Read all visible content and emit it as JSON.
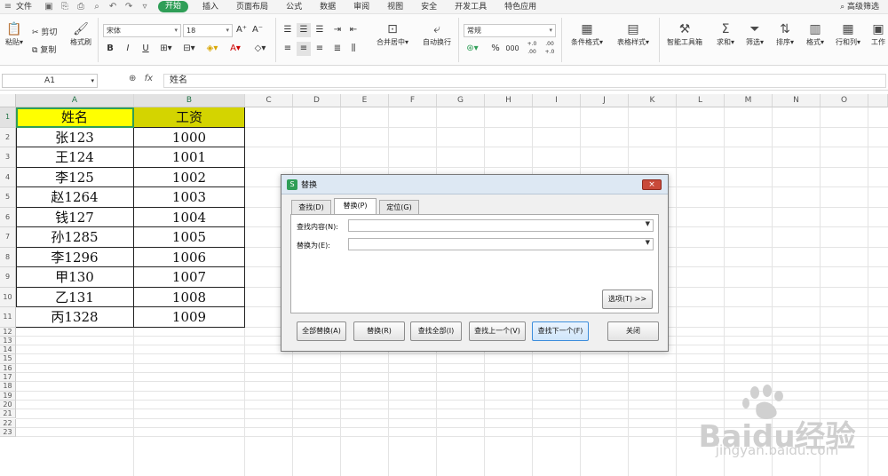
{
  "menubar": {
    "file": "文件",
    "tabs": [
      "开始",
      "插入",
      "页面布局",
      "公式",
      "数据",
      "审阅",
      "视图",
      "安全",
      "开发工具",
      "特色应用"
    ],
    "active_tab": "开始",
    "search": "高级筛选"
  },
  "ribbon": {
    "paste": "粘贴",
    "cut": "剪切",
    "copy": "复制",
    "format_painter": "格式刷",
    "font": "宋体",
    "font_size": "18",
    "bold": "B",
    "italic": "I",
    "underline": "U",
    "merge": "合并居中",
    "wrap": "自动换行",
    "number_format": "常规",
    "percent": "%",
    "thousands": "000",
    "dec_inc": "+.0\n.00",
    "dec_dec": ".00\n+.0",
    "cond_format": "条件格式",
    "table_style": "表格样式",
    "smart_toolbox": "智能工具箱",
    "sum": "求和",
    "filter": "筛选",
    "sort": "排序",
    "format": "格式",
    "row_col": "行和列",
    "worksheet": "工作"
  },
  "formula_bar": {
    "cell_ref": "A1",
    "fx": "fx",
    "value": "姓名"
  },
  "grid": {
    "columns": [
      "A",
      "B",
      "C",
      "D",
      "E",
      "F",
      "G",
      "H",
      "I",
      "J",
      "K",
      "L",
      "M",
      "N",
      "O"
    ],
    "rows": [
      "1",
      "2",
      "3",
      "4",
      "5",
      "6",
      "7",
      "8",
      "9",
      "10",
      "11",
      "12",
      "13",
      "14",
      "15",
      "16",
      "17",
      "18",
      "19",
      "20",
      "21",
      "22",
      "23"
    ],
    "header": [
      "姓名",
      "工资"
    ],
    "data": [
      [
        "张123",
        "1000"
      ],
      [
        "王124",
        "1001"
      ],
      [
        "李125",
        "1002"
      ],
      [
        "赵1264",
        "1003"
      ],
      [
        "钱127",
        "1004"
      ],
      [
        "孙1285",
        "1005"
      ],
      [
        "李1296",
        "1006"
      ],
      [
        "甲130",
        "1007"
      ],
      [
        "乙131",
        "1008"
      ],
      [
        "丙1328",
        "1009"
      ]
    ]
  },
  "dialog": {
    "icon": "S",
    "title": "替换",
    "tabs": [
      "查找(D)",
      "替换(P)",
      "定位(G)"
    ],
    "find_label": "查找内容(N):",
    "replace_label": "替换为(E):",
    "options": "选项(T) >>",
    "buttons": [
      "全部替换(A)",
      "替换(R)",
      "查找全部(I)",
      "查找上一个(V)",
      "查找下一个(F)",
      "关闭"
    ]
  },
  "watermark": {
    "brand": "Baidu经验",
    "url": "jingyan.baidu.com"
  },
  "colors": {
    "accent": "#2f9e57",
    "header_a1": "#ffff00",
    "header_b1": "#d4d400"
  }
}
